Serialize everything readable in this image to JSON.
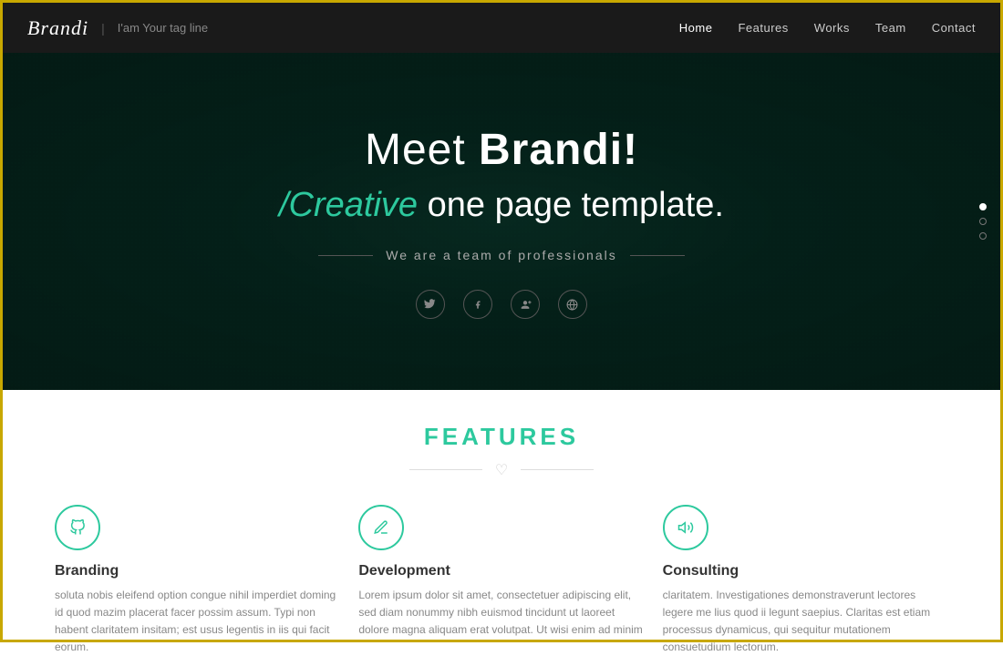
{
  "navbar": {
    "brand": "Brandi",
    "divider": "|",
    "tagline": "I'am Your tag line",
    "nav_items": [
      {
        "label": "Home",
        "active": true
      },
      {
        "label": "Features",
        "active": false
      },
      {
        "label": "Works",
        "active": false
      },
      {
        "label": "Team",
        "active": false
      },
      {
        "label": "Contact",
        "active": false
      }
    ]
  },
  "hero": {
    "title_prefix": "Meet ",
    "title_brand": "Brandi!",
    "subtitle_accent": "/Creative",
    "subtitle_rest": " one page template.",
    "tagline": "We are a team of professionals",
    "social_icons": [
      "twitter",
      "facebook",
      "google-plus",
      "globe"
    ],
    "dots": [
      "active",
      "hollow",
      "hollow"
    ]
  },
  "features": {
    "section_title": "FEATURES",
    "items": [
      {
        "icon": "🎵",
        "title": "Branding",
        "text": "soluta nobis eleifend option congue nihil imperdiet doming id quod mazim placerat facer possim assum. Typi non habent claritatem insitam; est usus legentis in iis qui facit eorum."
      },
      {
        "icon": "✏",
        "title": "Development",
        "text": "Lorem ipsum dolor sit amet, consectetuer adipiscing elit, sed diam nonummy nibh euismod tincidunt ut laoreet dolore magna aliquam erat volutpat. Ut wisi enim ad minim"
      },
      {
        "icon": "📣",
        "title": "Consulting",
        "text": "claritatem. Investigationes demonstraverunt lectores legere me lius quod ii legunt saepius. Claritas est etiam processus dynamicus, qui sequitur mutationem consuetudium lectorum."
      }
    ]
  },
  "colors": {
    "accent": "#2dc99e",
    "dark_bg": "#1a1a1a",
    "hero_bg": "#041f18",
    "border": "#c8a800"
  }
}
